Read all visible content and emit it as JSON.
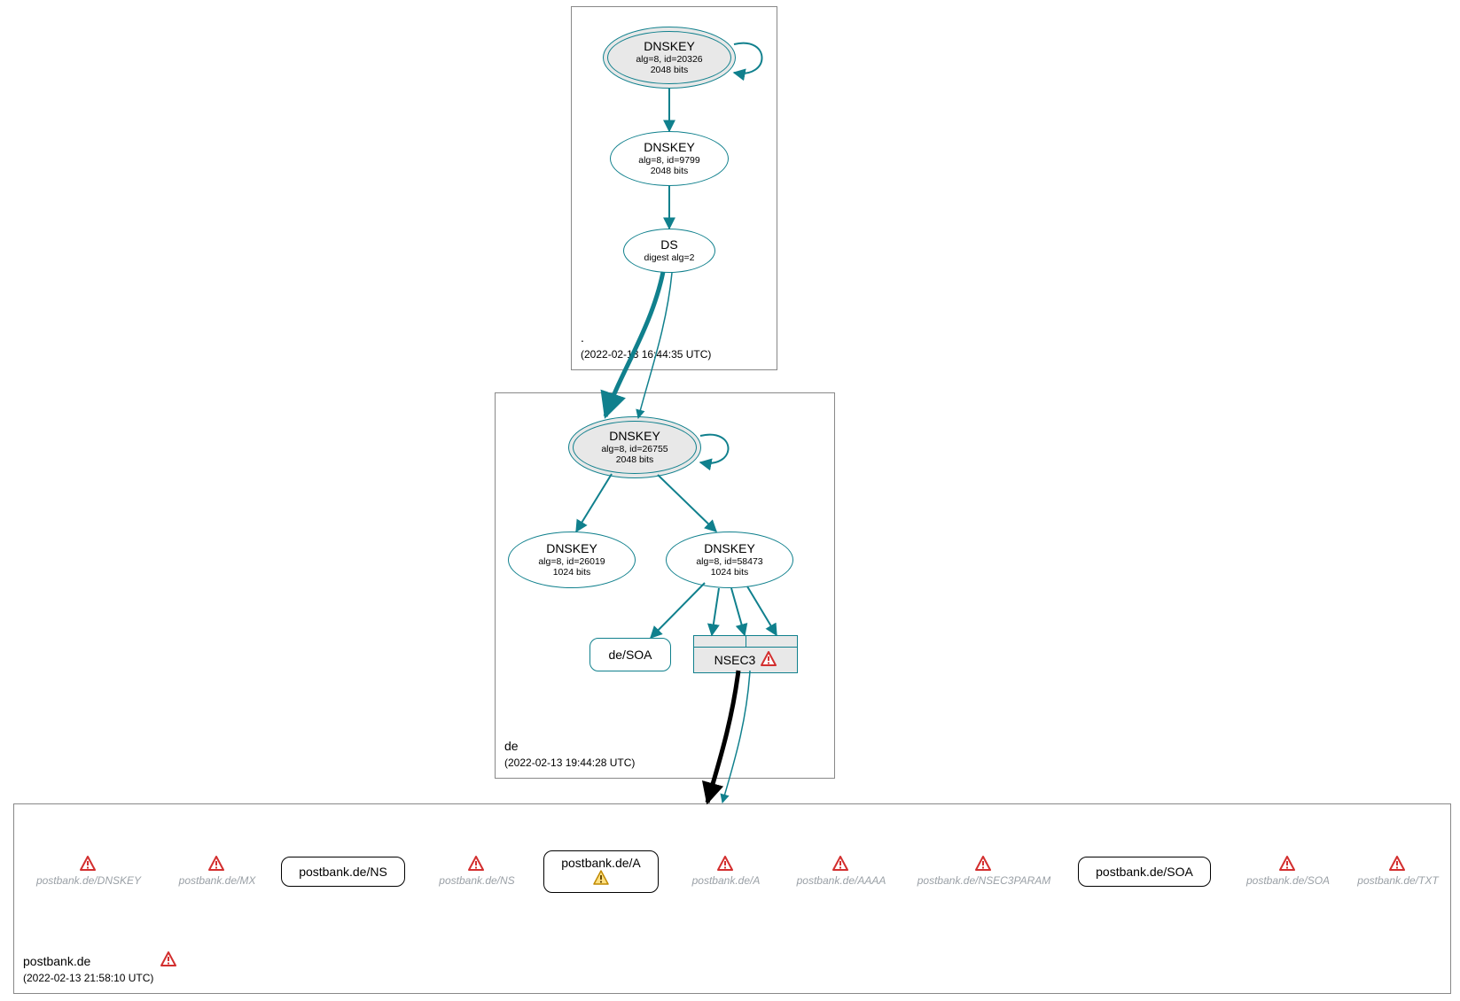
{
  "zones": {
    "root": {
      "name": ".",
      "timestamp": "(2022-02-13 16:44:35 UTC)"
    },
    "de": {
      "name": "de",
      "timestamp": "(2022-02-13 19:44:28 UTC)"
    },
    "postbank": {
      "name": "postbank.de",
      "timestamp": "(2022-02-13 21:58:10 UTC)"
    }
  },
  "nodes": {
    "root_ksk": {
      "title": "DNSKEY",
      "sub1": "alg=8, id=20326",
      "sub2": "2048 bits"
    },
    "root_zsk": {
      "title": "DNSKEY",
      "sub1": "alg=8, id=9799",
      "sub2": "2048 bits"
    },
    "root_ds": {
      "title": "DS",
      "sub1": "digest alg=2"
    },
    "de_ksk": {
      "title": "DNSKEY",
      "sub1": "alg=8, id=26755",
      "sub2": "2048 bits"
    },
    "de_zsk1": {
      "title": "DNSKEY",
      "sub1": "alg=8, id=26019",
      "sub2": "1024 bits"
    },
    "de_zsk2": {
      "title": "DNSKEY",
      "sub1": "alg=8, id=58473",
      "sub2": "1024 bits"
    },
    "de_soa": {
      "label": "de/SOA"
    },
    "nsec3": {
      "label": "NSEC3"
    }
  },
  "bottom": {
    "postbank_dnskey": {
      "label": "postbank.de/DNSKEY",
      "status": "error",
      "ghost": true
    },
    "postbank_mx": {
      "label": "postbank.de/MX",
      "status": "error",
      "ghost": true
    },
    "postbank_ns_solid": {
      "label": "postbank.de/NS",
      "status": "ok",
      "ghost": false
    },
    "postbank_ns_ghost": {
      "label": "postbank.de/NS",
      "status": "error",
      "ghost": true
    },
    "postbank_a_solid": {
      "label": "postbank.de/A",
      "status": "warn",
      "ghost": false
    },
    "postbank_a_ghost": {
      "label": "postbank.de/A",
      "status": "error",
      "ghost": true
    },
    "postbank_aaaa": {
      "label": "postbank.de/AAAA",
      "status": "error",
      "ghost": true
    },
    "postbank_nsec3param": {
      "label": "postbank.de/NSEC3PARAM",
      "status": "error",
      "ghost": true
    },
    "postbank_soa_solid": {
      "label": "postbank.de/SOA",
      "status": "ok",
      "ghost": false
    },
    "postbank_soa_ghost": {
      "label": "postbank.de/SOA",
      "status": "error",
      "ghost": true
    },
    "postbank_txt": {
      "label": "postbank.de/TXT",
      "status": "error",
      "ghost": true
    }
  },
  "zone_status": {
    "postbank": "error"
  },
  "colors": {
    "teal": "#10808d",
    "ghost": "#9aa0a6",
    "error": "#d32f2f",
    "warn": "#f9a825"
  }
}
